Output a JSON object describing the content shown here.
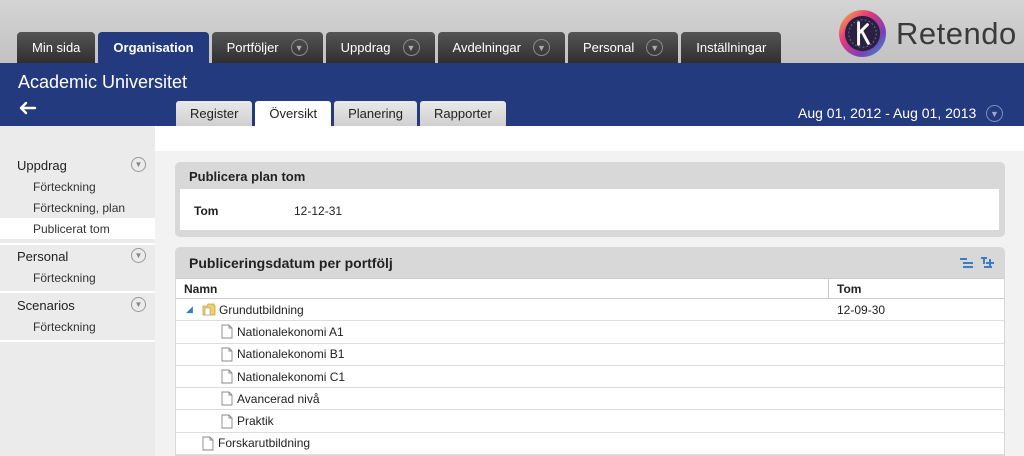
{
  "topnav": {
    "tabs": [
      {
        "label": "Min sida",
        "dropdown": false,
        "active": false
      },
      {
        "label": "Organisation",
        "dropdown": false,
        "active": true
      },
      {
        "label": "Portföljer",
        "dropdown": true,
        "active": false
      },
      {
        "label": "Uppdrag",
        "dropdown": true,
        "active": false
      },
      {
        "label": "Avdelningar",
        "dropdown": true,
        "active": false
      },
      {
        "label": "Personal",
        "dropdown": true,
        "active": false
      },
      {
        "label": "Inställningar",
        "dropdown": false,
        "active": false
      }
    ]
  },
  "brand": {
    "name": "Retendo",
    "accent": "#233b7e"
  },
  "header": {
    "title": "Academic Universitet",
    "subtabs": [
      {
        "label": "Register",
        "active": false
      },
      {
        "label": "Översikt",
        "active": true
      },
      {
        "label": "Planering",
        "active": false
      },
      {
        "label": "Rapporter",
        "active": false
      }
    ],
    "date_range": "Aug 01, 2012 - Aug 01, 2013"
  },
  "sidebar": {
    "sections": [
      {
        "label": "Uppdrag",
        "items": [
          {
            "label": "Förteckning",
            "active": false
          },
          {
            "label": "Förteckning, plan",
            "active": false
          },
          {
            "label": "Publicerat tom",
            "active": true
          }
        ]
      },
      {
        "label": "Personal",
        "items": [
          {
            "label": "Förteckning",
            "active": false
          }
        ]
      },
      {
        "label": "Scenarios",
        "items": [
          {
            "label": "Förteckning",
            "active": false
          }
        ]
      }
    ]
  },
  "publish_panel": {
    "title": "Publicera plan tom",
    "field_label": "Tom",
    "field_value": "12-12-31"
  },
  "portfolio_panel": {
    "title": "Publiceringsdatum per portfölj",
    "columns": [
      "Namn",
      "Tom"
    ],
    "rows": [
      {
        "name": "Grundutbildning",
        "tom": "12-09-30",
        "level": 0,
        "type": "folder",
        "expanded": true
      },
      {
        "name": "Nationalekonomi A1",
        "tom": "",
        "level": 1,
        "type": "doc"
      },
      {
        "name": "Nationalekonomi B1",
        "tom": "",
        "level": 1,
        "type": "doc"
      },
      {
        "name": "Nationalekonomi C1",
        "tom": "",
        "level": 1,
        "type": "doc"
      },
      {
        "name": "Avancerad nivå",
        "tom": "",
        "level": 1,
        "type": "doc"
      },
      {
        "name": "Praktik",
        "tom": "",
        "level": 1,
        "type": "doc"
      },
      {
        "name": "Forskarutbildning",
        "tom": "",
        "level": 0,
        "type": "doc"
      }
    ]
  }
}
